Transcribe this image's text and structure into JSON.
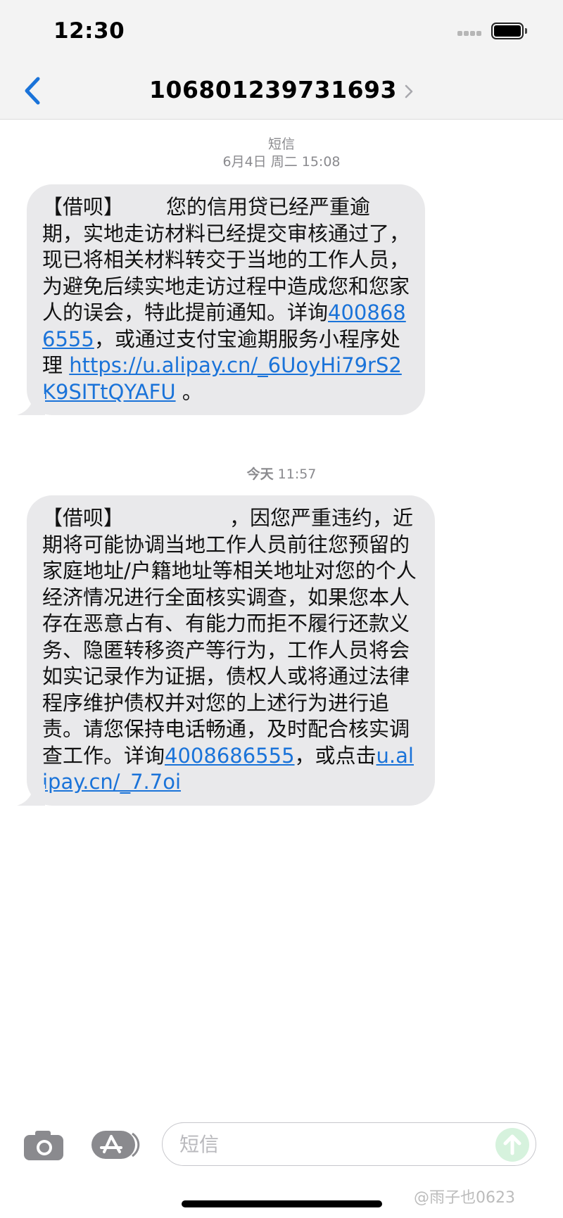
{
  "status_bar": {
    "time": "12:30"
  },
  "header": {
    "contact": "106801239731693"
  },
  "messages": [
    {
      "label": "短信",
      "timestamp": "6月4日 周二 15:08",
      "text_before": "【借呗】",
      "text_main": "您的信用贷已经严重逾期，实地走访材料已经提交审核通过了，现已将相关材料转交于当地的工作人员，为避免后续实地走访过程中造成您和您家人的误会，特此提前通知。详询",
      "phone": "4008686555",
      "text_mid": "，或通过支付宝逾期服务小程序处理 ",
      "link": "https://u.alipay.cn/_6UoyHi79rS2K9SITtQYAFU",
      "text_end": " 。"
    },
    {
      "timestamp_day": "今天",
      "timestamp_time": "11:57",
      "text_before": "【借呗】",
      "text_main": "，因您严重违约，近期将可能协调当地工作人员前往您预留的家庭地址/户籍地址等相关地址对您的个人经济情况进行全面核实调查，如果您本人存在恶意占有、有能力而拒不履行还款义务、隐匿转移资产等行为，工作人员将会如实记录作为证据，债权人或将通过法律程序维护债权并对您的上述行为进行追责。请您保持电话畅通，及时配合核实调查工作。详询",
      "phone": "4008686555",
      "text_mid": "，或点击",
      "link": "u.alipay.cn/_7.7oi"
    }
  ],
  "input": {
    "placeholder": "短信"
  },
  "watermark": "@雨子也0623",
  "colors": {
    "bubble": "#e9e9eb",
    "link": "#1a73d9",
    "accent": "#1a73d9",
    "send": "#d6f2dd"
  }
}
